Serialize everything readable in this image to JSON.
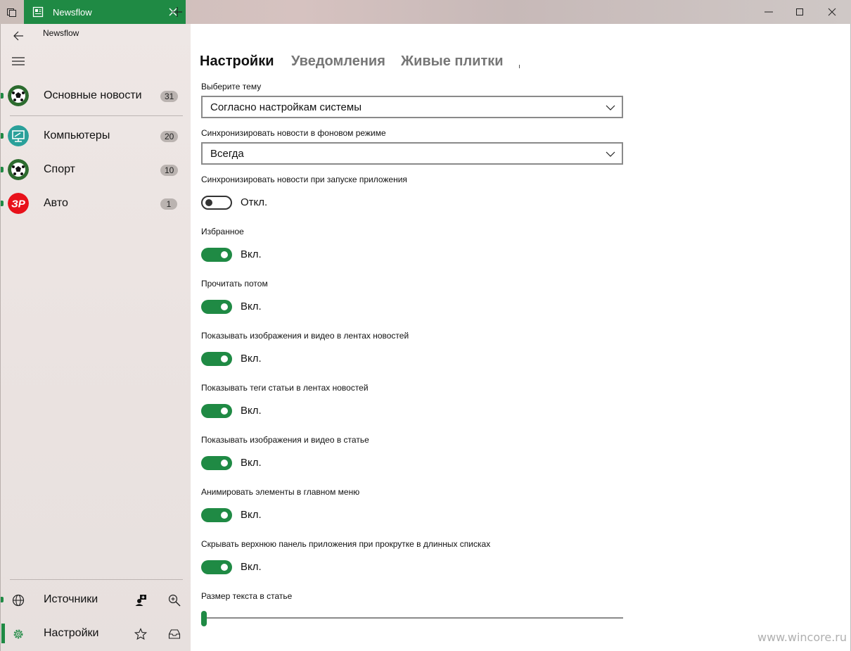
{
  "window": {
    "tab_title": "Newsflow",
    "accent_color": "#1f8a44"
  },
  "sidebar": {
    "app_name": "Newsflow",
    "feeds": [
      {
        "label": "Основные новости",
        "count": "31",
        "icon": "soccer-ball-icon"
      },
      {
        "label": "Компьютеры",
        "count": "20",
        "icon": "computer-monitor-icon"
      },
      {
        "label": "Спорт",
        "count": "10",
        "icon": "soccer-ball-icon"
      },
      {
        "label": "Авто",
        "count": "1",
        "icon": "zr-logo-icon"
      }
    ],
    "logo_text": "ЗР",
    "bottom": [
      {
        "label": "Источники",
        "icon": "globe-icon",
        "actions": [
          "add-person-icon",
          "zoom-in-icon"
        ]
      },
      {
        "label": "Настройки",
        "icon": "gear-icon",
        "actions": [
          "star-icon",
          "inbox-icon"
        ]
      }
    ]
  },
  "tabs": [
    {
      "label": "Настройки",
      "active": true
    },
    {
      "label": "Уведомления",
      "active": false
    },
    {
      "label": "Живые плитки",
      "active": false
    }
  ],
  "settings": {
    "theme": {
      "label": "Выберите тему",
      "value": "Согласно настройкам системы"
    },
    "bg_sync": {
      "label": "Синхронизировать новости в фоновом режиме",
      "value": "Всегда"
    },
    "toggles": [
      {
        "label": "Синхронизировать новости при запуске приложения",
        "on": false,
        "state": "Откл."
      },
      {
        "label": "Избранное",
        "on": true,
        "state": "Вкл."
      },
      {
        "label": "Прочитать потом",
        "on": true,
        "state": "Вкл."
      },
      {
        "label": "Показывать изображения и видео в лентах новостей",
        "on": true,
        "state": "Вкл."
      },
      {
        "label": "Показывать теги статьи в лентах новостей",
        "on": true,
        "state": "Вкл."
      },
      {
        "label": "Показывать изображения и видео в статье",
        "on": true,
        "state": "Вкл."
      },
      {
        "label": "Анимировать элементы в главном меню",
        "on": true,
        "state": "Вкл."
      },
      {
        "label": "Скрывать верхнюю панель приложения при прокрутке в длинных списках",
        "on": true,
        "state": "Вкл."
      }
    ],
    "text_size": {
      "label": "Размер текста в статье",
      "value_fraction": 0.0
    }
  },
  "watermark": "www.wincore.ru"
}
